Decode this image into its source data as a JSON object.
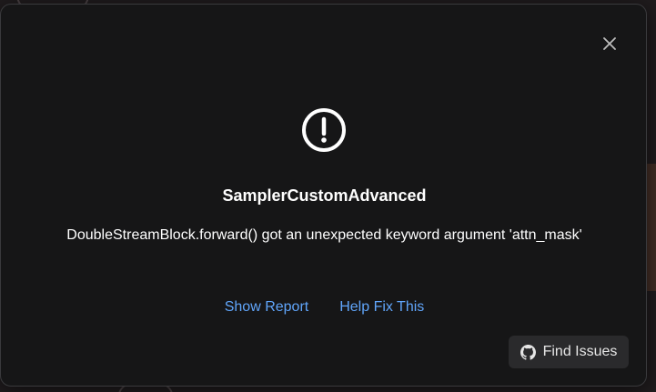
{
  "dialog": {
    "title": "SamplerCustomAdvanced",
    "message": "DoubleStreamBlock.forward() got an unexpected keyword argument 'attn_mask'",
    "show_report_label": "Show Report",
    "help_fix_label": "Help Fix This",
    "find_issues_label": "Find Issues",
    "icons": {
      "close": "close-icon",
      "alert": "alert-circle-icon",
      "github": "github-icon"
    },
    "colors": {
      "background": "#161617",
      "link": "#60a5fa",
      "text": "#ffffff",
      "button_bg": "#2a2a2c"
    }
  }
}
